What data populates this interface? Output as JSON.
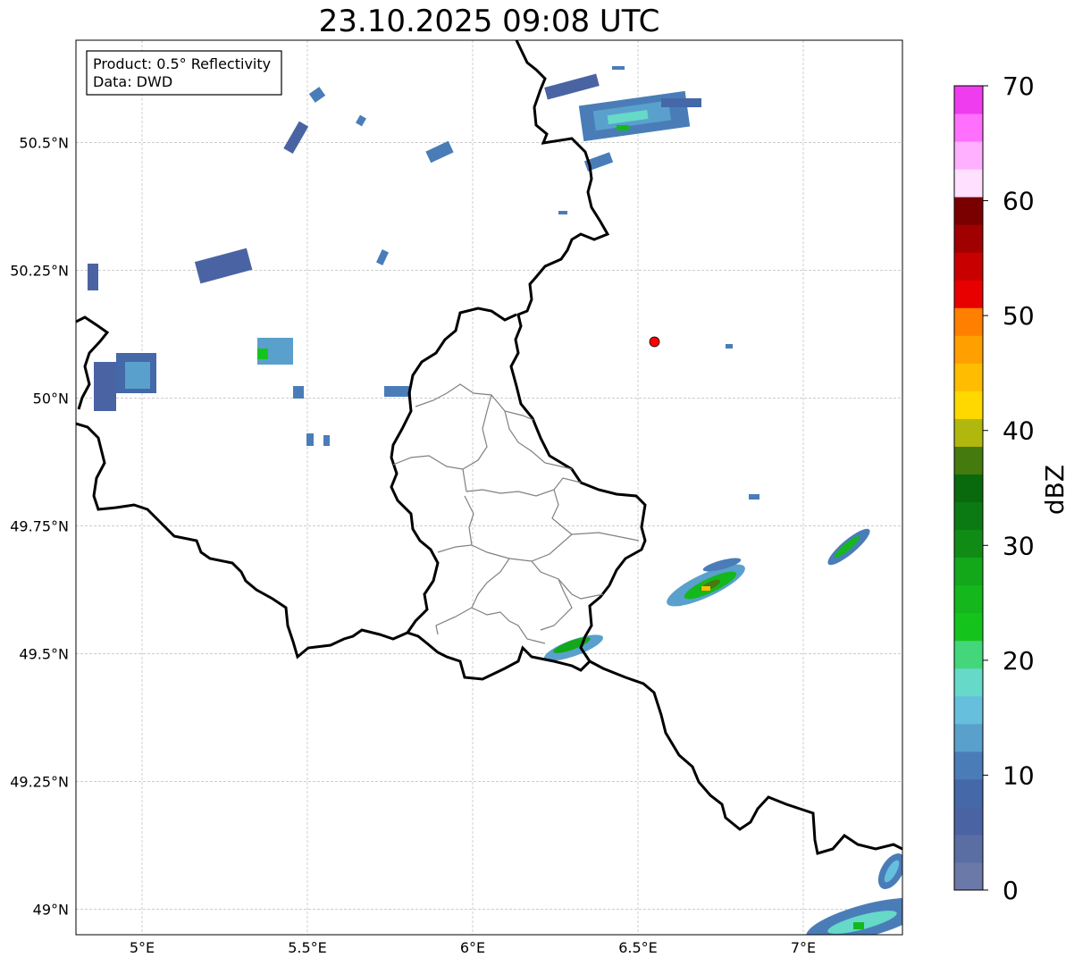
{
  "title": "23.10.2025 09:08 UTC",
  "info_box": {
    "product": "Product: 0.5° Reflectivity",
    "data": "Data: DWD"
  },
  "map": {
    "lon_range": [
      4.8,
      7.3
    ],
    "lat_range": [
      48.95,
      50.7
    ],
    "grid": true,
    "x_ticks": [
      {
        "value": 5.0,
        "label": "5°E"
      },
      {
        "value": 5.5,
        "label": "5.5°E"
      },
      {
        "value": 6.0,
        "label": "6°E"
      },
      {
        "value": 6.5,
        "label": "6.5°E"
      },
      {
        "value": 7.0,
        "label": "7°E"
      }
    ],
    "y_ticks": [
      {
        "value": 49.0,
        "label": "49°N"
      },
      {
        "value": 49.25,
        "label": "49.25°N"
      },
      {
        "value": 49.5,
        "label": "49.5°N"
      },
      {
        "value": 49.75,
        "label": "49.75°N"
      },
      {
        "value": 50.0,
        "label": "50°N"
      },
      {
        "value": 50.25,
        "label": "50.25°N"
      },
      {
        "value": 50.5,
        "label": "50.5°N"
      }
    ],
    "radar_site": {
      "lon": 6.55,
      "lat": 50.11,
      "color": "#ff0000"
    }
  },
  "colorbar": {
    "unit": "dBZ",
    "min": 0,
    "max": 70,
    "ticks": [
      {
        "value": 0,
        "label": "0"
      },
      {
        "value": 10,
        "label": "10"
      },
      {
        "value": 20,
        "label": "20"
      },
      {
        "value": 30,
        "label": "30"
      },
      {
        "value": 40,
        "label": "40"
      },
      {
        "value": 50,
        "label": "50"
      },
      {
        "value": 60,
        "label": "60"
      },
      {
        "value": 70,
        "label": "70"
      }
    ],
    "colors": [
      "#6a79a8",
      "#5a6ea3",
      "#4a64a3",
      "#4468a8",
      "#4a7db8",
      "#5aa0cc",
      "#66c0dd",
      "#66d9c8",
      "#44d67a",
      "#14c41c",
      "#14b81c",
      "#12a81a",
      "#108c16",
      "#0c7a12",
      "#086a0c",
      "#457a0e",
      "#b0b80e",
      "#ffd800",
      "#ffbc00",
      "#ff9f00",
      "#ff7f00",
      "#e80000",
      "#c80000",
      "#a00000",
      "#7a0000",
      "#ffe0ff",
      "#ffb0ff",
      "#ff70ff",
      "#ee3cee"
    ]
  }
}
